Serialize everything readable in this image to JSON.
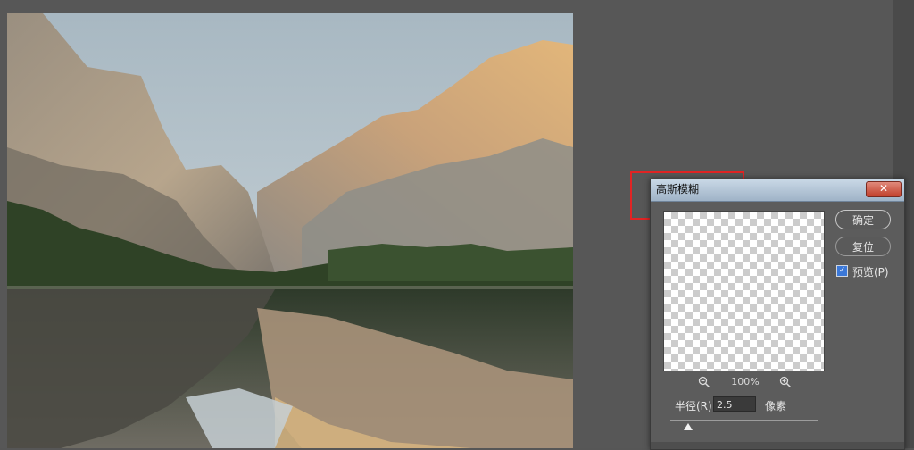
{
  "dialog": {
    "title": "高斯模糊",
    "close_glyph": "✕",
    "ok_label": "确定",
    "reset_label": "复位",
    "preview_label": "预览(P)",
    "preview_checked": true,
    "zoom_out_icon": "zoom-out-icon",
    "zoom_in_icon": "zoom-in-icon",
    "zoom_level": "100%",
    "radius_label": "半径(R):",
    "radius_value": "2.5",
    "radius_unit": "像素"
  },
  "colors": {
    "highlight": "#e12424",
    "titlebar": "#b6c8da",
    "checkbox": "#3b78d8"
  }
}
